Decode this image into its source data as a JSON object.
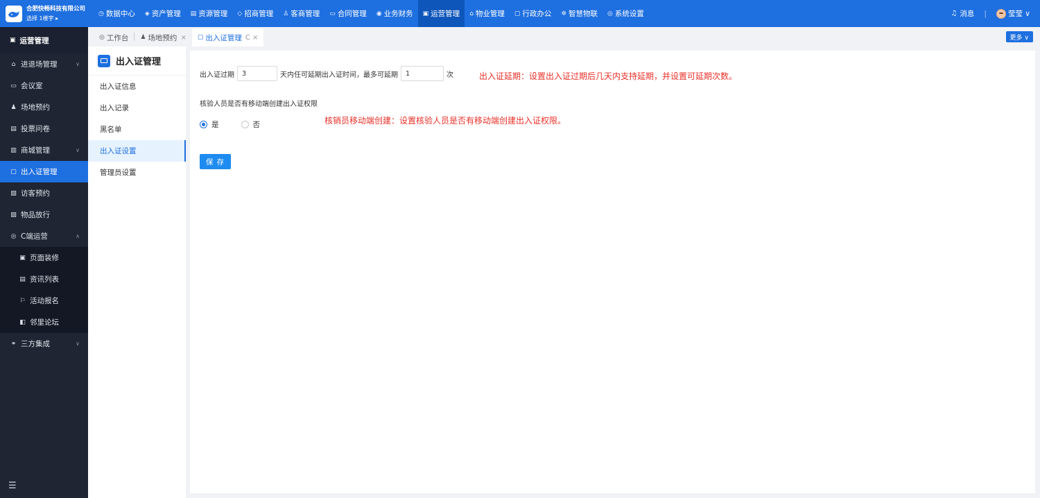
{
  "brand": {
    "name": "合肥快畅科技有限公司",
    "sub": "选择 1楼宇 ▸"
  },
  "topnav": [
    {
      "label": "数据中心",
      "icon": "dashboard-icon",
      "glyph": "◷"
    },
    {
      "label": "资产管理",
      "icon": "cube-icon",
      "glyph": "◈"
    },
    {
      "label": "资源管理",
      "icon": "building-icon",
      "glyph": "▤"
    },
    {
      "label": "招商管理",
      "icon": "tag-icon",
      "glyph": "◇"
    },
    {
      "label": "客商管理",
      "icon": "users-icon",
      "glyph": "♙"
    },
    {
      "label": "合同管理",
      "icon": "document-icon",
      "glyph": "▭"
    },
    {
      "label": "业务财务",
      "icon": "coin-icon",
      "glyph": "◉"
    },
    {
      "label": "运营管理",
      "icon": "operations-icon",
      "glyph": "▣",
      "active": true
    },
    {
      "label": "物业管理",
      "icon": "home-icon",
      "glyph": "⌂"
    },
    {
      "label": "行政办公",
      "icon": "monitor-icon",
      "glyph": "▢"
    },
    {
      "label": "智慧物联",
      "icon": "iot-icon",
      "glyph": "✲"
    },
    {
      "label": "系统设置",
      "icon": "settings-icon",
      "glyph": "◎"
    }
  ],
  "topright": {
    "messages": "消息",
    "sep": "|",
    "user": "莹莹 ∨"
  },
  "sidebar": {
    "title": "运营管理",
    "title_glyph": "▣",
    "items": [
      {
        "label": "进退场管理",
        "glyph": "⌂",
        "arrow": "∨"
      },
      {
        "label": "会议室",
        "glyph": "▭",
        "arrow": ""
      },
      {
        "label": "场地预约",
        "glyph": "♟",
        "arrow": ""
      },
      {
        "label": "投票问卷",
        "glyph": "▤",
        "arrow": ""
      },
      {
        "label": "商城管理",
        "glyph": "▥",
        "arrow": "∨"
      },
      {
        "label": "出入证管理",
        "glyph": "▢",
        "arrow": "",
        "active": true
      },
      {
        "label": "访客预约",
        "glyph": "▧",
        "arrow": ""
      },
      {
        "label": "物品放行",
        "glyph": "▨",
        "arrow": ""
      },
      {
        "label": "C端运营",
        "glyph": "◎",
        "arrow": "∧"
      }
    ],
    "sub_items": [
      {
        "label": "页面装修",
        "glyph": "▣"
      },
      {
        "label": "资讯列表",
        "glyph": "▤"
      },
      {
        "label": "活动报名",
        "glyph": "⚐"
      },
      {
        "label": "邻里论坛",
        "glyph": "◧"
      }
    ],
    "after_items": [
      {
        "label": "三方集成",
        "glyph": "⚭",
        "arrow": "∨"
      }
    ],
    "collapse_glyph": "☰"
  },
  "tabs": [
    {
      "label": "工作台",
      "glyph": "◎",
      "close": ""
    },
    {
      "label": "场地预约",
      "glyph": "♟",
      "close": "×"
    },
    {
      "label": "出入证管理",
      "glyph": "▢",
      "close": "C  ×",
      "active": true
    }
  ],
  "more_label": "更多 ∨",
  "subpanel": {
    "title": "出入证管理",
    "items": [
      {
        "label": "出入证信息"
      },
      {
        "label": "出入记录"
      },
      {
        "label": "黑名单"
      },
      {
        "label": "出入证设置",
        "active": true
      },
      {
        "label": "管理员设置"
      }
    ]
  },
  "settings": {
    "expire_label": "出入证过期",
    "expire_days": "3",
    "extend_text": "天内任可延期出入证时间，最多可延期",
    "max_times": "1",
    "times_unit": "次",
    "extend_note": "出入证延期：设置出入证过期后几天内支持延期，并设置可延期次数。",
    "mobile_label": "核验人员是否有移动端创建出入证权限",
    "radio_yes": "是",
    "radio_no": "否",
    "mobile_note": "核销员移动端创建：设置核验人员是否有移动端创建出入证权限。",
    "save": "保 存"
  }
}
